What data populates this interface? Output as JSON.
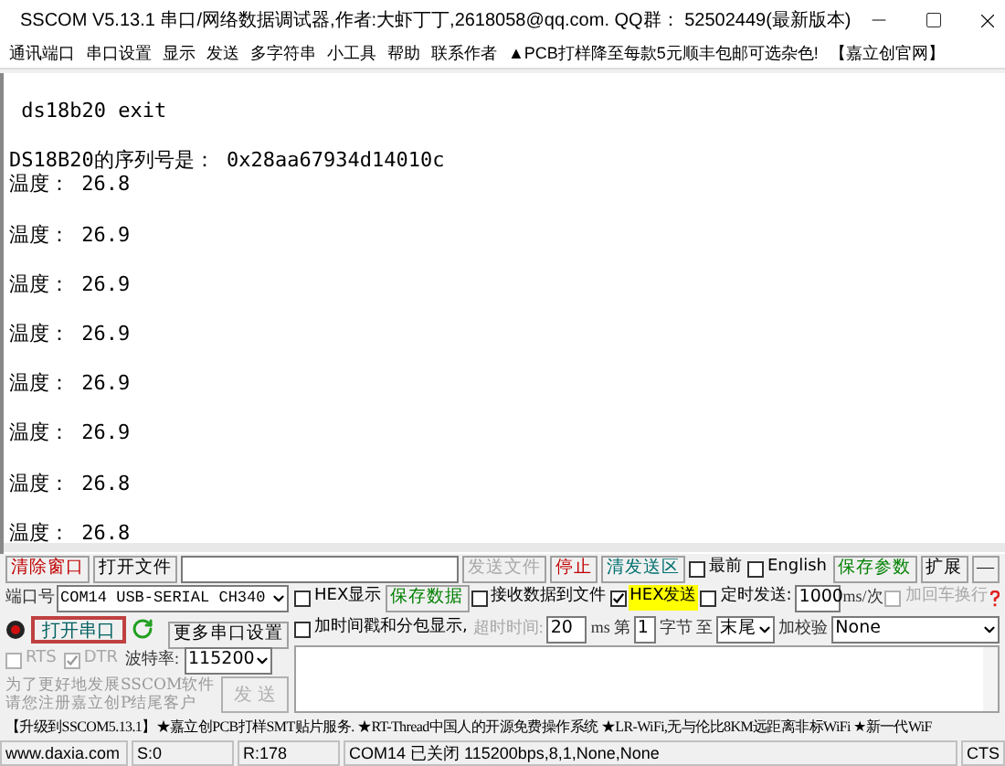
{
  "window": {
    "title": "SSCOM V5.13.1 串口/网络数据调试器,作者:大虾丁丁,2618058@qq.com. QQ群： 52502449(最新版本)"
  },
  "menu": [
    {
      "label": "通讯端口"
    },
    {
      "label": "串口设置"
    },
    {
      "label": "显示"
    },
    {
      "label": "发送"
    },
    {
      "label": "多字符串"
    },
    {
      "label": "小工具"
    },
    {
      "label": "帮助"
    },
    {
      "label": "联系作者"
    },
    {
      "label": "▲PCB打样降至每款5元顺丰包邮可选杂色!"
    },
    {
      "label": "【嘉立创官网】"
    }
  ],
  "terminal": {
    "lines": [
      {
        "kind": "blank"
      },
      {
        "kind": "text",
        "text": " ds18b20 exit"
      },
      {
        "kind": "blank"
      },
      {
        "kind": "text",
        "text": "DS18B20的序列号是： 0x28aa67934d14010c"
      },
      {
        "kind": "text",
        "text": "温度： 26.8"
      },
      {
        "kind": "blank"
      },
      {
        "kind": "text",
        "text": "温度： 26.9"
      },
      {
        "kind": "blank"
      },
      {
        "kind": "text",
        "text": "温度： 26.9"
      },
      {
        "kind": "blank"
      },
      {
        "kind": "text",
        "text": "温度： 26.9"
      },
      {
        "kind": "blank"
      },
      {
        "kind": "text",
        "text": "温度： 26.9"
      },
      {
        "kind": "blank"
      },
      {
        "kind": "text",
        "text": "温度： 26.9"
      },
      {
        "kind": "blank"
      },
      {
        "kind": "text",
        "text": "温度： 26.8"
      },
      {
        "kind": "blank"
      },
      {
        "kind": "text",
        "text": "温度： 26.8"
      }
    ]
  },
  "toolbar": {
    "clear_button": "清除窗口",
    "open_file_button": "打开文件",
    "send_file_button": {
      "label": "发送文件",
      "disabled": true
    },
    "stop_button": "停止",
    "clear_send_button": "清发送区",
    "topmost": {
      "label": "最前",
      "checked": false
    },
    "english": {
      "label": "English",
      "checked": false
    },
    "save_params_button": "保存参数",
    "expand_button": "扩展",
    "collapse_button": "—"
  },
  "port": {
    "label": "端口号",
    "value": "COM14 USB-SERIAL CH340",
    "open_button": "打开串口",
    "more_settings_button": "更多串口设置",
    "rts": {
      "label": "RTS",
      "checked": false,
      "disabled": true
    },
    "dtr": {
      "label": "DTR",
      "checked": true,
      "disabled": true
    },
    "baud_label": "波特率:",
    "baud": "115200",
    "notice": [
      "为了更好地发展SSCOM软件",
      "请您注册嘉立创P结尾客户"
    ],
    "send_button": {
      "label": "发 送",
      "disabled": true
    }
  },
  "receive": {
    "hex_display": {
      "label": "HEX显示",
      "checked": false
    },
    "save_data_button": "保存数据",
    "to_file": {
      "label": "接收数据到文件",
      "checked": false
    },
    "timestamp": {
      "label": "加时间戳和分包显示,",
      "checked": false
    },
    "timeout_label": {
      "text": "超时时间:",
      "disabled": true
    },
    "timeout": "20",
    "timeout_unit": "ms"
  },
  "send": {
    "hex_send": {
      "label": "HEX发送",
      "checked": true
    },
    "timed": {
      "label": "定时发送:",
      "checked": false
    },
    "interval": "1000",
    "interval_unit": "ms/次",
    "add_newline": {
      "label": "加回车换行",
      "checked": false,
      "disabled": true
    },
    "byte_from_label": "第",
    "byte_from": "1",
    "byte_label": "字节 至",
    "to": "末尾",
    "checksum_label": "加校验",
    "checksum": "None"
  },
  "marquee": "【升级到SSCOM5.13.1】★嘉立创PCB打样SMT贴片服务. ★RT-Thread中国人的开源免费操作系统 ★LR-WiFi,无与伦比8KM远距离非标WiFi ★新一代WiF",
  "status_bar": [
    {
      "text": "www.daxia.com"
    },
    {
      "text": "S:0"
    },
    {
      "text": "R:178"
    },
    {
      "text": "COM14 已关闭  115200bps,8,1,None,None"
    },
    {
      "text": "CTS"
    }
  ]
}
